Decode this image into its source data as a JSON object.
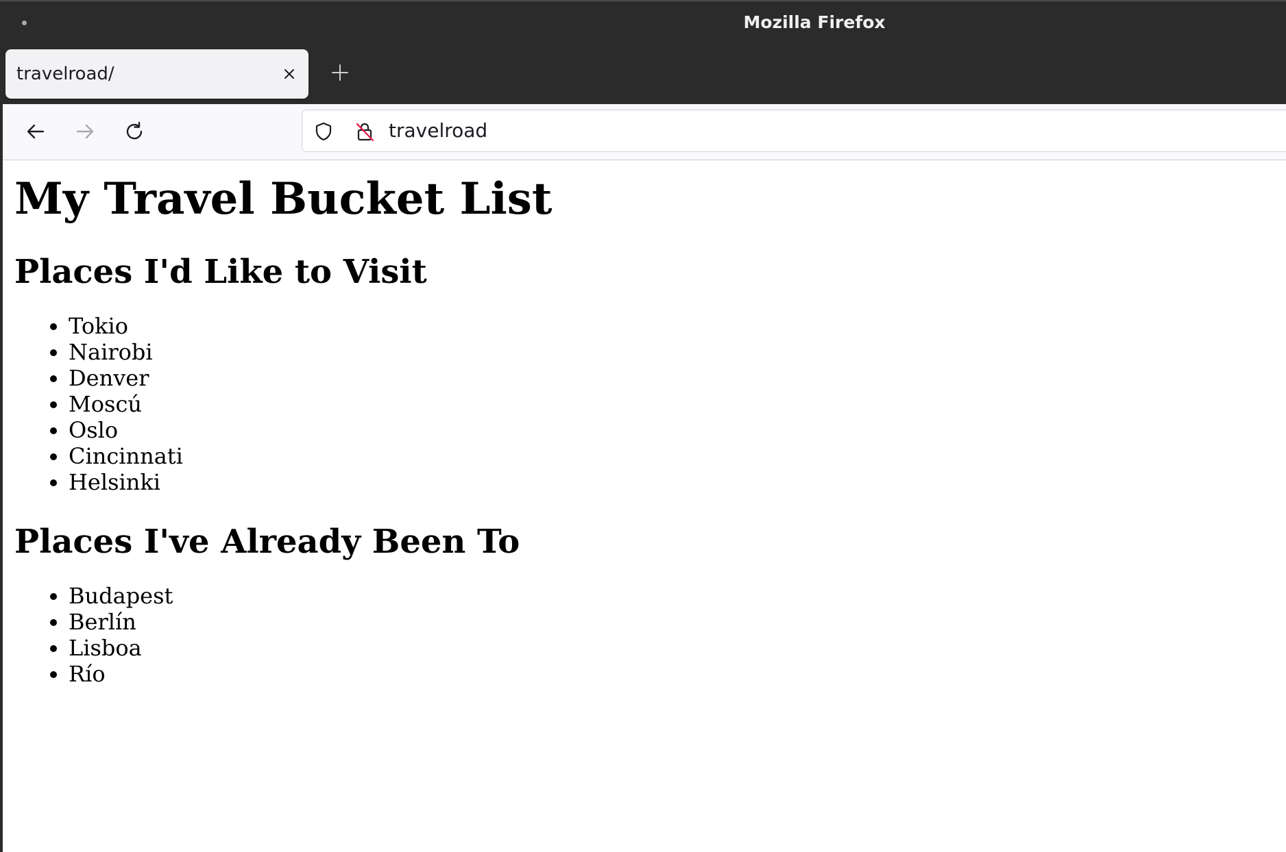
{
  "window": {
    "title": "Mozilla Firefox"
  },
  "tabs": [
    {
      "label": "travelroad/",
      "active": true
    }
  ],
  "toolbar": {
    "back_icon": "back-arrow-icon",
    "forward_icon": "forward-arrow-icon",
    "reload_icon": "reload-icon",
    "new_tab_icon": "plus-icon",
    "close_tab_icon": "close-icon"
  },
  "urlbar": {
    "value": "travelroad",
    "shield_icon": "shield-icon",
    "insecure_icon": "insecure-lock-icon"
  },
  "page": {
    "heading": "My Travel Bucket List",
    "sections": [
      {
        "title": "Places I'd Like to Visit",
        "items": [
          "Tokio",
          "Nairobi",
          "Denver",
          "Moscú",
          "Oslo",
          "Cincinnati",
          "Helsinki"
        ]
      },
      {
        "title": "Places I've Already Been To",
        "items": [
          "Budapest",
          "Berlín",
          "Lisboa",
          "Río"
        ]
      }
    ]
  },
  "colors": {
    "chrome_dark": "#2b2b2b",
    "tab_bg": "#f2f2f4",
    "navbar_bg": "#f9f9fb",
    "insecure_accent": "#e22850"
  }
}
